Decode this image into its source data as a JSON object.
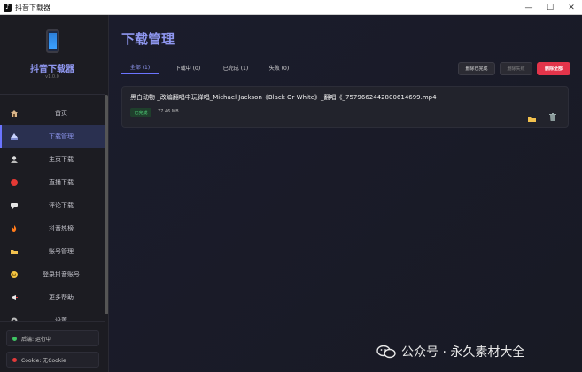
{
  "window": {
    "title": "抖音下载器",
    "controls": {
      "minimize": "—",
      "maximize": "☐",
      "close": "✕"
    }
  },
  "sidebar": {
    "app_name": "抖音下载器",
    "version": "v1.0.0",
    "items": [
      {
        "label": "首页",
        "icon": "home-icon",
        "active": false
      },
      {
        "label": "下载管理",
        "icon": "download-manager-icon",
        "active": true
      },
      {
        "label": "主页下载",
        "icon": "user-home-icon",
        "active": false
      },
      {
        "label": "直播下载",
        "icon": "live-record-icon",
        "active": false
      },
      {
        "label": "评论下载",
        "icon": "comment-icon",
        "active": false
      },
      {
        "label": "抖音热榜",
        "icon": "fire-icon",
        "active": false
      },
      {
        "label": "账号管理",
        "icon": "folder-icon",
        "active": false
      },
      {
        "label": "登录抖音账号",
        "icon": "login-icon",
        "active": false
      },
      {
        "label": "更多帮助",
        "icon": "megaphone-icon",
        "active": false
      },
      {
        "label": "设置",
        "icon": "gear-icon",
        "active": false
      }
    ],
    "status": {
      "backend": "后端: 运行中",
      "cookie": "Cookie: 无Cookie",
      "backend_color": "#3fc463",
      "cookie_color": "#e23a3a"
    }
  },
  "main": {
    "title": "下载管理",
    "tabs": [
      {
        "label": "全部 (1)",
        "active": true
      },
      {
        "label": "下载中 (0)",
        "active": false
      },
      {
        "label": "已完成 (1)",
        "active": false
      },
      {
        "label": "失败 (0)",
        "active": false
      }
    ],
    "actions": {
      "clear_completed": "删除已完成",
      "clear_failed": "删除失败",
      "clear_all": "删除全部"
    },
    "downloads": [
      {
        "filename": "黑白动物 _改编翻唱中玩弹唱_Michael Jackson《Black Or White》_翻唱《_7579662442800614699.mp4",
        "status": "已完成",
        "size": "77.46 MB"
      }
    ]
  },
  "watermark": {
    "text": "公众号 · 永久素材大全"
  },
  "colors": {
    "accent": "#8f97f0",
    "danger": "#e3344a",
    "success": "#4fd37a"
  }
}
